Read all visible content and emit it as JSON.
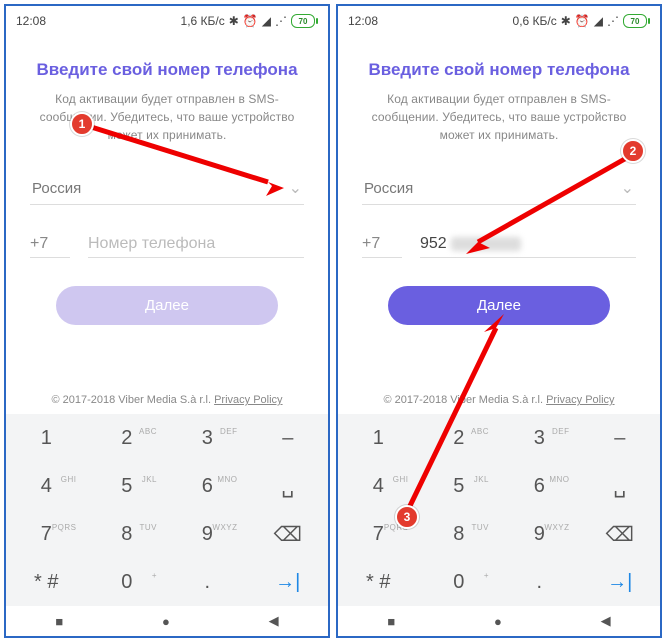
{
  "status": {
    "time": "12:08",
    "net1": "1,6 КБ/с",
    "net2": "0,6 КБ/с",
    "batt": "70"
  },
  "screen": {
    "title": "Введите свой номер телефона",
    "subtitle": "Код активации будет отправлен в SMS-сообщении. Убедитесь, что ваше устройство может их принимать.",
    "country": "Россия",
    "code": "+7",
    "placeholder": "Номер телефона",
    "value_partial": "952",
    "next": "Далее",
    "copyright": "© 2017-2018 Viber Media S.à r.l.",
    "privacy": "Privacy Policy"
  },
  "keys": [
    {
      "d": "1",
      "s": ""
    },
    {
      "d": "2",
      "s": "ABC"
    },
    {
      "d": "3",
      "s": "DEF"
    },
    {
      "d": "–",
      "s": ""
    },
    {
      "d": "4",
      "s": "GHI"
    },
    {
      "d": "5",
      "s": "JKL"
    },
    {
      "d": "6",
      "s": "MNO"
    },
    {
      "d": "␣",
      "s": ""
    },
    {
      "d": "7",
      "s": "PQRS"
    },
    {
      "d": "8",
      "s": "TUV"
    },
    {
      "d": "9",
      "s": "WXYZ"
    },
    {
      "d": "⌫",
      "s": ""
    },
    {
      "d": "* #",
      "s": ""
    },
    {
      "d": "0",
      "s": "+"
    },
    {
      "d": ".",
      "s": ""
    },
    {
      "d": "go",
      "s": ""
    }
  ],
  "markers": {
    "m1": "1",
    "m2": "2",
    "m3": "3"
  }
}
